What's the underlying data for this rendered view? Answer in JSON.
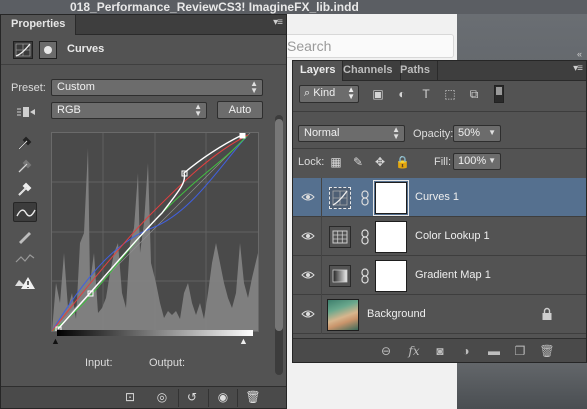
{
  "background": {
    "window_title": "018_Performance_ReviewCS3! ImagineFX_lib.indd",
    "search_placeholder": "Search"
  },
  "properties": {
    "tab_label": "Properties",
    "adjustment_title": "Curves",
    "preset_label": "Preset:",
    "preset_value": "Custom",
    "channel_value": "RGB",
    "auto_label": "Auto",
    "input_label": "Input:",
    "output_label": "Output:"
  },
  "layers": {
    "tabs": [
      {
        "label": "Layers",
        "active": true
      },
      {
        "label": "Channels",
        "active": false
      },
      {
        "label": "Paths",
        "active": false
      }
    ],
    "kind_filter": "Kind",
    "blend_mode": "Normal",
    "opacity_label": "Opacity:",
    "opacity_value": "50%",
    "lock_label": "Lock:",
    "fill_label": "Fill:",
    "fill_value": "100%",
    "items": [
      {
        "name": "Curves 1",
        "selected": true,
        "icon": "curves-icon"
      },
      {
        "name": "Color Lookup 1",
        "selected": false,
        "icon": "grid-icon"
      },
      {
        "name": "Gradient Map 1",
        "selected": false,
        "icon": "gradient-icon"
      },
      {
        "name": "Background",
        "selected": false,
        "icon": "photo-thumbnail"
      }
    ]
  },
  "colors": {
    "panel_bg": "#535353",
    "selected_layer": "#55708f",
    "curve_white": "#ffffff",
    "curve_red": "#e04040",
    "curve_green": "#40c040",
    "curve_blue": "#4060e0"
  }
}
